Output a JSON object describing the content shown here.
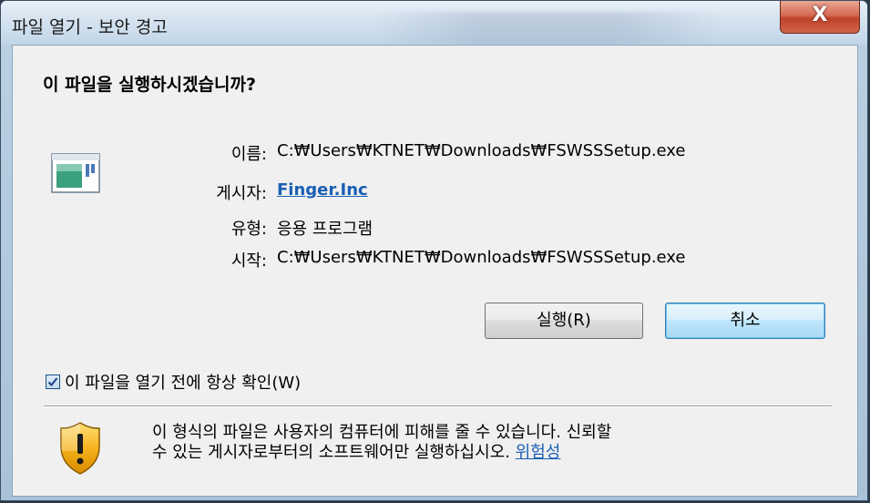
{
  "window": {
    "title": "파일 열기 - 보안 경고",
    "close_label": "X"
  },
  "dialog": {
    "heading": "이 파일을 실행하시겠습니까?",
    "fields": [
      {
        "label": "이름:",
        "value": "C:₩Users₩KTNET₩Downloads₩FSWSSSetup.exe"
      },
      {
        "label": "게시자:",
        "value": "Finger.Inc"
      },
      {
        "label": "유형:",
        "value": "응용 프로그램"
      },
      {
        "label": "시작:",
        "value": "C:₩Users₩KTNET₩Downloads₩FSWSSSetup.exe"
      }
    ],
    "buttons": {
      "run": "실행(R)",
      "cancel": "취소"
    },
    "checkbox": {
      "label": "이 파일을 열기 전에 항상 확인(W)",
      "checked": true
    },
    "warning": {
      "line1": "이 형식의 파일은 사용자의 컴퓨터에 피해를 줄 수 있습니다. 신뢰할",
      "line2": "수 있는 게시자로부터의 소프트웨어만 실행하십시오.",
      "link": "위험성"
    },
    "icons": {
      "app": "application-icon",
      "shield": "warning-shield-icon"
    }
  }
}
